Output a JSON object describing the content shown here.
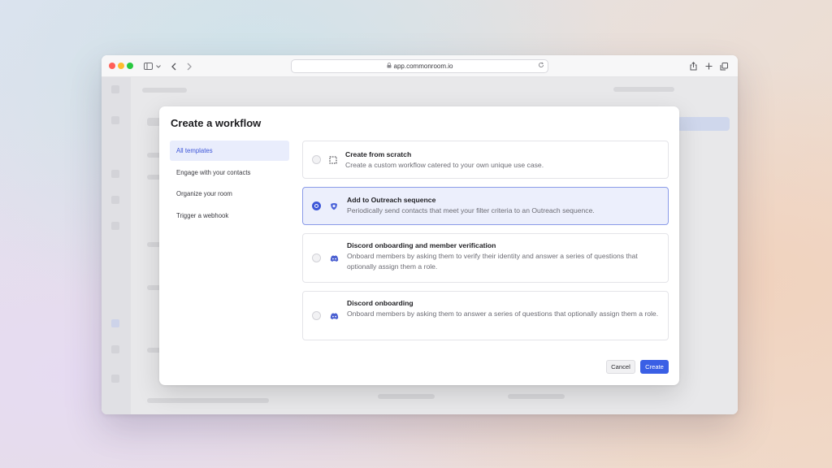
{
  "browser": {
    "url": "app.commonroom.io"
  },
  "modal": {
    "title": "Create a workflow",
    "nav": [
      {
        "label": "All templates",
        "active": true
      },
      {
        "label": "Engage with your contacts",
        "active": false
      },
      {
        "label": "Organize your room",
        "active": false
      },
      {
        "label": "Trigger a webhook",
        "active": false
      }
    ],
    "options": [
      {
        "title": "Create from scratch",
        "description": "Create a custom workflow catered to your own unique use case.",
        "icon": "dashed-square-icon",
        "selected": false
      },
      {
        "title": "Add to Outreach sequence",
        "description": "Periodically send contacts that meet your filter criteria to an Outreach sequence.",
        "icon": "outreach-icon",
        "selected": true
      },
      {
        "title": "Discord onboarding and member verification",
        "description": "Onboard members by asking them to verify their identity and answer a series of questions that optionally assign them a role.",
        "icon": "discord-icon",
        "selected": false
      },
      {
        "title": "Discord onboarding",
        "description": "Onboard members by asking them to answer a series of questions that optionally assign them a role.",
        "icon": "discord-icon",
        "selected": false
      }
    ],
    "cancel_label": "Cancel",
    "create_label": "Create"
  },
  "colors": {
    "accent": "#3a5fe5",
    "selected_bg": "#eceffc"
  }
}
